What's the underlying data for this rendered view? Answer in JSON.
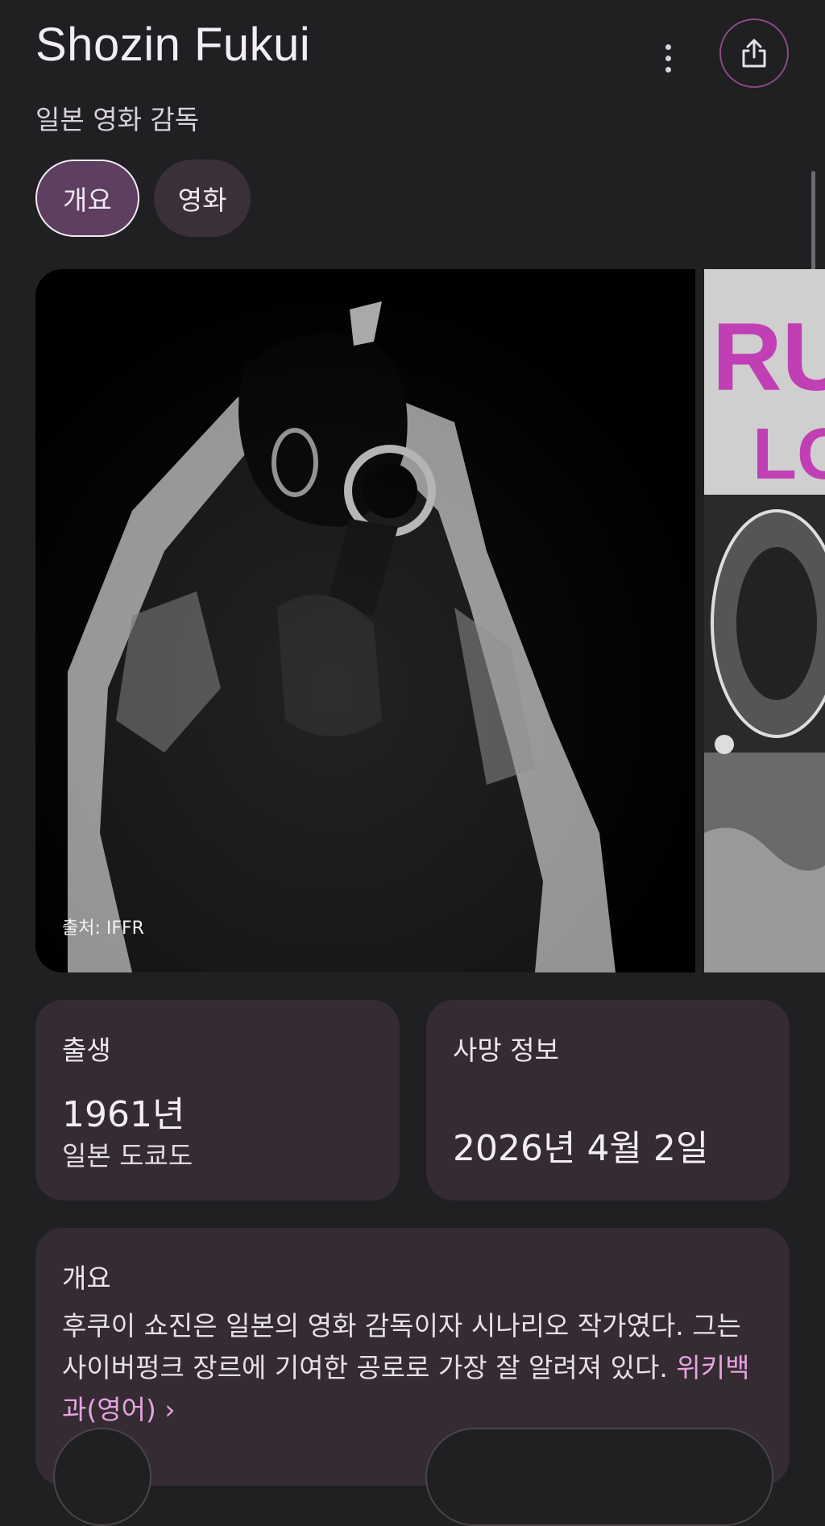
{
  "header": {
    "title": "Shozin Fukui",
    "subtitle": "일본 영화 감독"
  },
  "tabs": [
    {
      "label": "개요",
      "active": true
    },
    {
      "label": "영화",
      "active": false
    }
  ],
  "images": {
    "caption": "출처: IFFR",
    "second_poster_text": "RU LO"
  },
  "born_card": {
    "label": "출생",
    "year": "1961년",
    "place": "일본 도쿄도"
  },
  "death_card": {
    "label": "사망 정보",
    "date": "2026년 4월 2일"
  },
  "overview": {
    "label": "개요",
    "text": "후쿠이 쇼진은 일본의 영화 감독이자 시나리오 작가였다. 그는 사이버펑크 장르에 기여한 공로로 가장 잘 알려져 있다.",
    "source_link": "위키백과(영어)"
  },
  "colors": {
    "background": "#201f21",
    "card": "#342b33",
    "accent": "#5e3f5f",
    "link": "#e6a3e0"
  }
}
